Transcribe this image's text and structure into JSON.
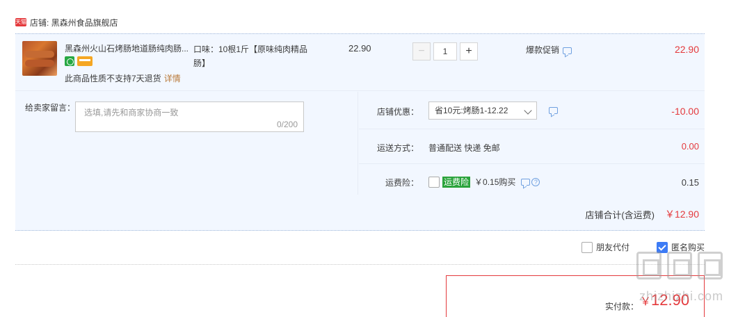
{
  "shop": {
    "badge": "天猫",
    "name": "店铺: 黑森州食品旗舰店"
  },
  "item": {
    "title": "黑森州火山石烤肠地道肠纯肉肠...",
    "spec": "口味：10根1斤【原味纯肉精品肠】",
    "return_note": "此商品性质不支持7天退货",
    "detail_link": "详情",
    "unit_price": "22.90",
    "quantity": "1",
    "minus": "−",
    "plus": "+",
    "promo": "爆款促销",
    "subtotal": "22.90"
  },
  "message": {
    "label": "给卖家留言：",
    "placeholder": "选填,请先和商家协商一致",
    "count": "0/200"
  },
  "coupon": {
    "label": "店铺优惠：",
    "selected": "省10元:烤肠1-12.22",
    "value": "-10.00"
  },
  "shipping": {
    "label": "运送方式：",
    "method": "普通配送 快递 免邮",
    "value": "0.00"
  },
  "insurance": {
    "label": "运费险：",
    "badge": "运费险",
    "price": "￥0.15购买",
    "help": "?",
    "value": "0.15"
  },
  "shop_total": {
    "label": "店铺合计(含运费)",
    "value": "￥12.90"
  },
  "options": {
    "friend_pay": "朋友代付",
    "anonymous": "匿名购买"
  },
  "payment": {
    "label": "实付款：",
    "currency": "￥",
    "amount": "12.90"
  },
  "watermark": {
    "text": "zhizhizhi.com"
  },
  "colors": {
    "accent_red": "#e4393c",
    "panel_bg": "#f2f7ff",
    "insurance_green": "#2aa33b",
    "check_blue": "#3d7bf5"
  }
}
